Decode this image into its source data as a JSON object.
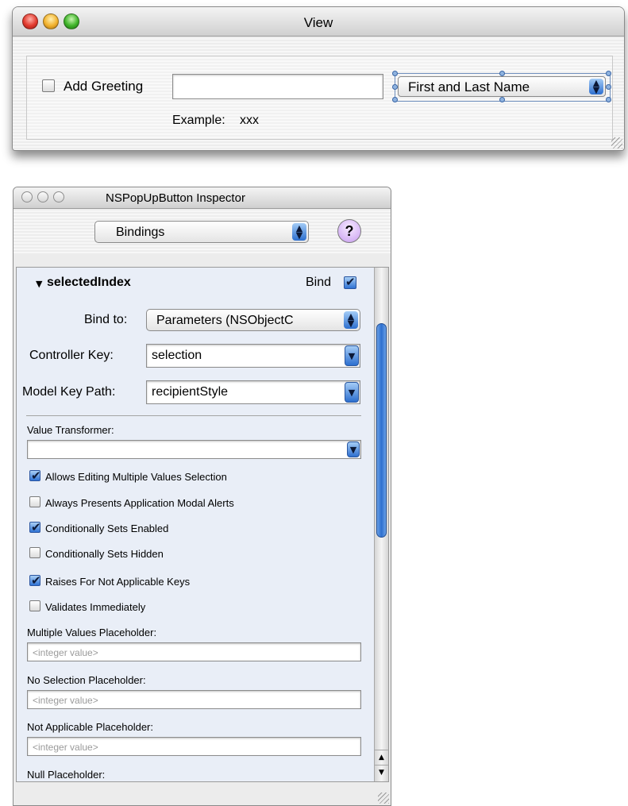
{
  "view_window": {
    "title": "View",
    "add_greeting_label": "Add Greeting",
    "add_greeting_checked": false,
    "greeting_text_value": "",
    "name_style_popup_value": "First and Last Name",
    "example_label": "Example:",
    "example_value": "xxx"
  },
  "inspector": {
    "title": "NSPopUpButton Inspector",
    "pane_popup_value": "Bindings",
    "help_button_label": "?",
    "binding_section": {
      "disclosure": "▼",
      "name": "selectedIndex",
      "bind_label": "Bind",
      "bind_checked": true
    },
    "bind_to": {
      "label": "Bind to:",
      "value": "Parameters (NSObjectC"
    },
    "controller_key": {
      "label": "Controller Key:",
      "value": "selection"
    },
    "model_key_path": {
      "label": "Model Key Path:",
      "value": "recipientStyle"
    },
    "value_transformer": {
      "label": "Value Transformer:",
      "value": ""
    },
    "options": [
      {
        "label": "Allows Editing Multiple Values Selection",
        "checked": true
      },
      {
        "label": "Always Presents Application Modal Alerts",
        "checked": false
      },
      {
        "label": "Conditionally Sets Enabled",
        "checked": true
      },
      {
        "label": "Conditionally Sets Hidden",
        "checked": false
      },
      {
        "label": "Raises For Not Applicable Keys",
        "checked": true
      },
      {
        "label": "Validates Immediately",
        "checked": false
      }
    ],
    "placeholders": [
      {
        "label": "Multiple Values Placeholder:",
        "placeholder": "<integer value>"
      },
      {
        "label": "No Selection Placeholder:",
        "placeholder": "<integer value>"
      },
      {
        "label": "Not Applicable Placeholder:",
        "placeholder": "<integer value>"
      },
      {
        "label": "Null Placeholder:"
      }
    ],
    "scroll_up_arrow": "▲",
    "scroll_down_arrow": "▼"
  },
  "colors": {
    "accent_blue": "#2d6fcf",
    "panel_bg": "#e9eef7",
    "window_bg": "#ececec"
  }
}
